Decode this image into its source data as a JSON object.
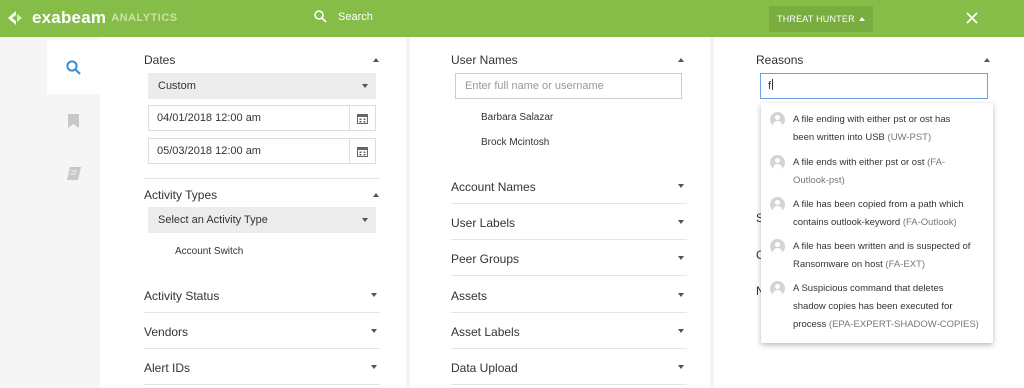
{
  "topbar": {
    "logo_text": "exabeam",
    "logo_sub": "ANALYTICS",
    "search_label": "Search",
    "threat_hunter_label": "THREAT HUNTER",
    "colors": {
      "bar": "#86bd48",
      "threat_button": "#7aad40"
    }
  },
  "sidebar": {
    "icons": [
      "search-icon",
      "bookmark-icon",
      "notes-icon"
    ],
    "active": "search-icon"
  },
  "col1": {
    "dates": {
      "title": "Dates",
      "range_select": "Custom",
      "start": "04/01/2018 12:00 am",
      "end": "05/03/2018 12:00 am"
    },
    "activity_types": {
      "title": "Activity Types",
      "placeholder": "Select an Activity Type",
      "selected": [
        "Account Switch"
      ]
    },
    "collapsed": [
      "Activity Status",
      "Vendors",
      "Alert IDs"
    ]
  },
  "col2": {
    "user_names": {
      "title": "User Names",
      "placeholder": "Enter full name or username",
      "selected": [
        "Barbara Salazar",
        "Brock Mcintosh"
      ]
    },
    "collapsed": [
      "Account Names",
      "User Labels",
      "Peer Groups",
      "Assets",
      "Asset Labels",
      "Data Upload"
    ]
  },
  "col3": {
    "reasons": {
      "title": "Reasons",
      "input_value": "f",
      "suggestions": [
        {
          "line1": "A file ending with either pst or ost has",
          "line2": "been written into USB",
          "code": "(UW-PST)"
        },
        {
          "line1": "A file ends with either pst or ost",
          "code1": "(FA-",
          "line2": "",
          "code": "Outlook-pst)"
        },
        {
          "line1": "A file has been copied from a path which",
          "line2": "contains outlook-keyword",
          "code": "(FA-Outlook)"
        },
        {
          "line1": "A file has been written and is suspected of",
          "line2": "Ransomware on host",
          "code": "(FA-EXT)"
        },
        {
          "line1": "A Suspicious command that deletes",
          "line2": "shadow copies has been executed for",
          "line3": "process",
          "code": "(EPA-EXPERT-SHADOW-COPIES)"
        }
      ]
    },
    "hidden_rows_initials": [
      "S",
      "C",
      "N"
    ]
  }
}
